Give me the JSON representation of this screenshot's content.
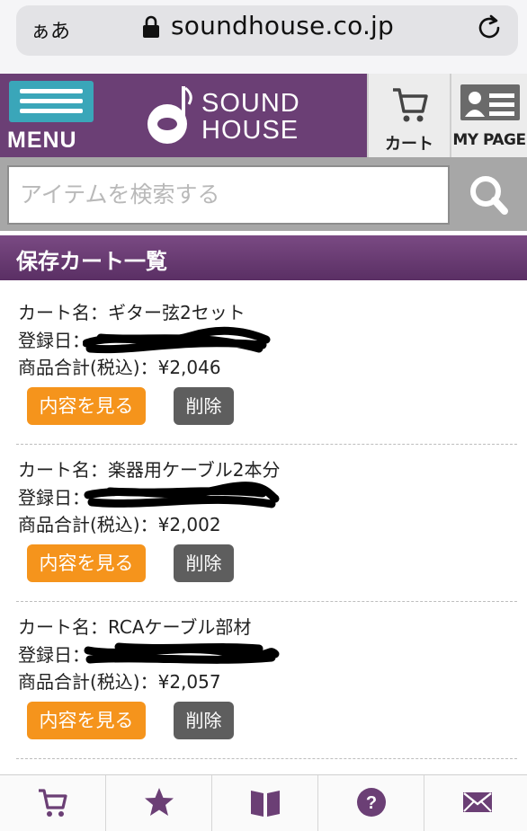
{
  "browser": {
    "aa_label": "ぁあ",
    "url": "soundhouse.co.jp",
    "icons": [
      "lock-icon",
      "reload-icon"
    ]
  },
  "header": {
    "menu_label": "MENU",
    "logo_line1": "SOUND",
    "logo_line2": "HOUSE",
    "cart_label": "カート",
    "mypage_label": "MY PAGE",
    "brand_color": "#6b3f75",
    "menu_color": "#3aa6b9"
  },
  "search": {
    "placeholder": "アイテムを検索する"
  },
  "section": {
    "title": "保存カート一覧"
  },
  "carts": [
    {
      "name_line": "カート名：ギター弦2セット",
      "date_label": "登録日：",
      "total_line": "商品合計(税込)：¥2,046",
      "view_label": "内容を見る",
      "delete_label": "削除"
    },
    {
      "name_line": "カート名：楽器用ケーブル2本分",
      "date_label": "登録日：",
      "total_line": "商品合計(税込)：¥2,002",
      "view_label": "内容を見る",
      "delete_label": "削除"
    },
    {
      "name_line": "カート名：RCAケーブル部材",
      "date_label": "登録日：",
      "total_line": "商品合計(税込)：¥2,057",
      "view_label": "内容を見る",
      "delete_label": "削除"
    }
  ],
  "colors": {
    "view_button": "#f5941c",
    "delete_button": "#5e5e5e",
    "nav_icon": "#6b3f75"
  },
  "bottom_nav": {
    "icons": [
      "cart-icon",
      "star-icon",
      "book-icon",
      "help-icon",
      "mail-icon"
    ]
  }
}
